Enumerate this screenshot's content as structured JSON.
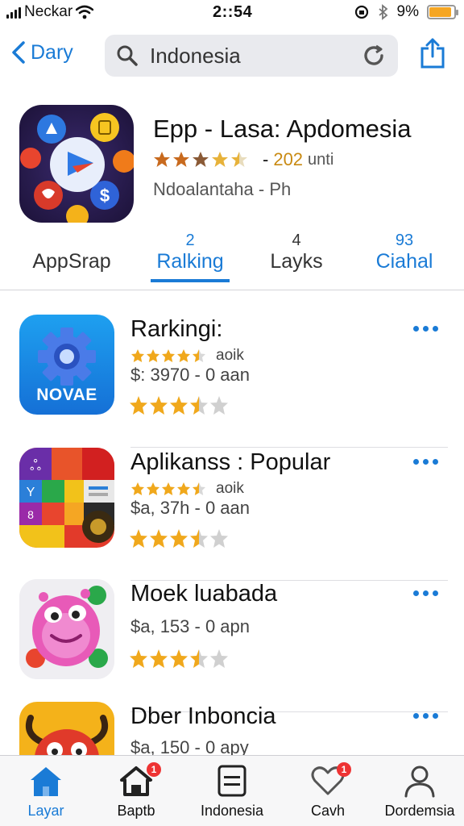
{
  "status_bar": {
    "carrier": "Neckar",
    "time": "2::54",
    "battery": "9%",
    "battery_level": 0.9
  },
  "nav": {
    "back_label": "Dary",
    "search_text": "Indonesia"
  },
  "featured_app": {
    "title": "Epp - Lasa: Apdomesia",
    "rating_stars": 3.5,
    "rating_count": "202",
    "rating_unit": "unti",
    "subtitle": "Ndoalantaha - Ph"
  },
  "tabs": [
    {
      "number": "",
      "label": "AppSrap"
    },
    {
      "number": "2",
      "label": "Ralking"
    },
    {
      "number": "4",
      "label": "Layks"
    },
    {
      "number": "93",
      "label": "Ciahal"
    }
  ],
  "apps": [
    {
      "title": "Rarkingi:",
      "small_stars": 4,
      "small_label": "aoik",
      "price": "$: 3970 - 0 aan",
      "big_stars": 3.5,
      "icon_text": "NOVAE"
    },
    {
      "title": "Aplikanss : Popular",
      "small_stars": 4,
      "small_label": "aoik",
      "price": "$a, 37h - 0 aan",
      "big_stars": 3.5
    },
    {
      "title": "Moek luabada",
      "price": "$a, 153 - 0 apn",
      "big_stars": 3.5
    },
    {
      "title": "Dber Inboncia",
      "price": "$a, 150 - 0 apy"
    }
  ],
  "tab_bar": [
    {
      "label": "Layar",
      "badge": ""
    },
    {
      "label": "Baptb",
      "badge": "1"
    },
    {
      "label": "Indonesia",
      "badge": ""
    },
    {
      "label": "Cavh",
      "badge": "1"
    },
    {
      "label": "Dordemsia",
      "badge": ""
    }
  ],
  "colors": {
    "accent": "#1a7bd6",
    "star": "#f0a81c",
    "badge": "#e33333"
  }
}
